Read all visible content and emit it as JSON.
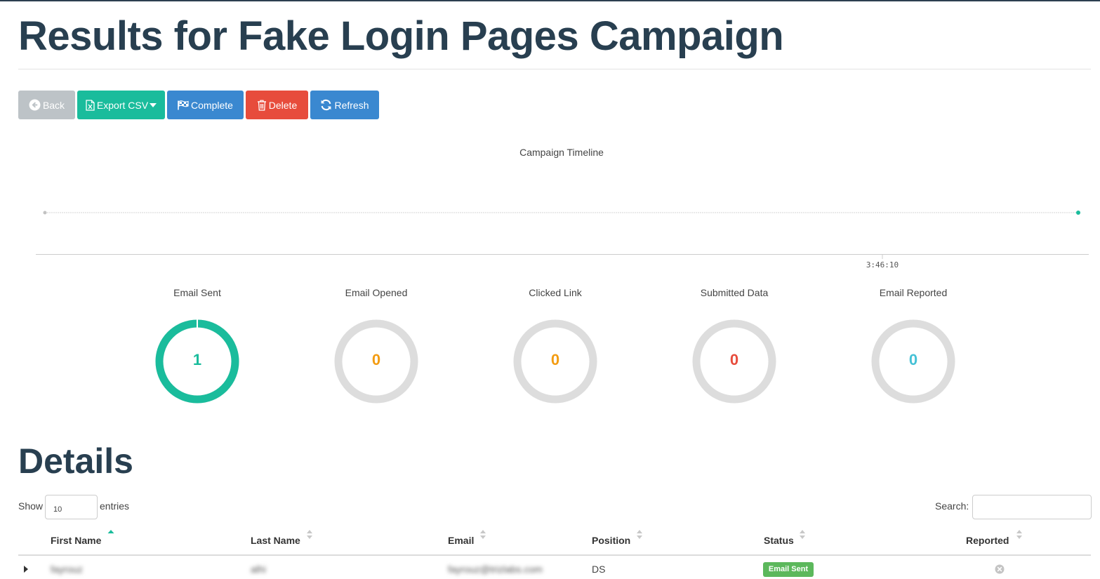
{
  "page": {
    "title": "Results for Fake Login Pages Campaign"
  },
  "toolbar": {
    "back_label": "Back",
    "export_label": "Export CSV",
    "complete_label": "Complete",
    "delete_label": "Delete",
    "refresh_label": "Refresh"
  },
  "chart_data": {
    "type": "scatter",
    "title": "Campaign Timeline",
    "x_ticks": [
      "3:46:10"
    ],
    "series": [
      {
        "x": [
          0.0,
          1.0
        ],
        "y": [
          0,
          0
        ]
      }
    ]
  },
  "stats": [
    {
      "label": "Email Sent",
      "value": "1",
      "fraction": 1.0,
      "color": "#1abc9c"
    },
    {
      "label": "Email Opened",
      "value": "0",
      "fraction": 0,
      "color": "#f39c12"
    },
    {
      "label": "Clicked Link",
      "value": "0",
      "fraction": 0,
      "color": "#f39c12"
    },
    {
      "label": "Submitted Data",
      "value": "0",
      "fraction": 0,
      "color": "#e74c3c"
    },
    {
      "label": "Email Reported",
      "value": "0",
      "fraction": 0,
      "color": "#45c1d6"
    }
  ],
  "details": {
    "title": "Details",
    "show_label": "Show",
    "page_size": "10",
    "entries_label": "entries",
    "search_label": "Search:",
    "columns": [
      "First Name",
      "Last Name",
      "Email",
      "Position",
      "Status",
      "Reported"
    ],
    "rows": [
      {
        "first_name": "fayrouz",
        "last_name": "alhi",
        "email": "fayrouz@trizlabs.com",
        "position": "DS",
        "status": "Email Sent"
      }
    ]
  },
  "colors": {
    "teal": "#1abc9c",
    "blue": "#3a88d0",
    "red": "#e74c3c",
    "grey": "#bdc3c7",
    "heading": "#283f50",
    "ring_track": "#dddddd",
    "success": "#5cb85c"
  }
}
